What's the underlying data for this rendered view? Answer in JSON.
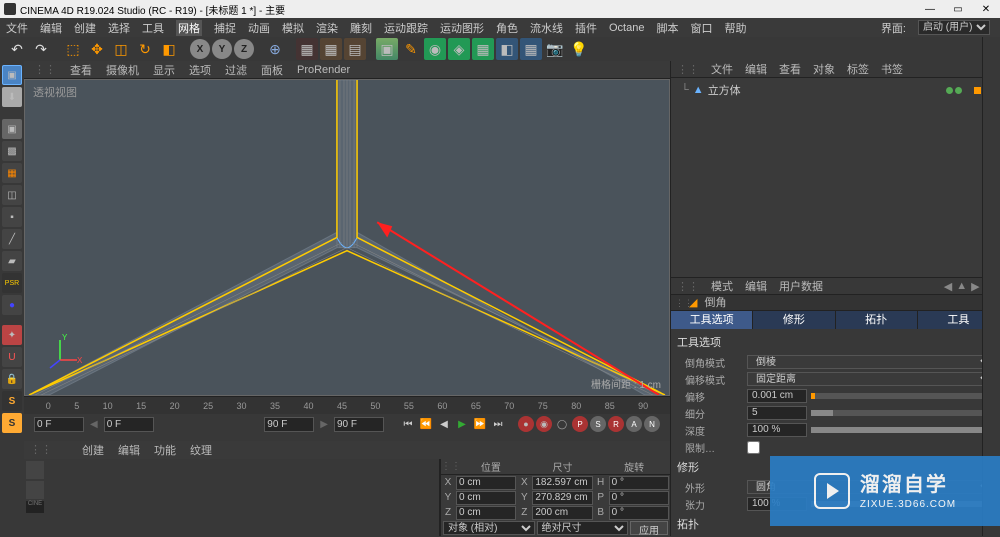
{
  "title": "CINEMA 4D R19.024 Studio (RC - R19) - [未标题 1 *] - 主要",
  "menus": [
    "文件",
    "编辑",
    "创建",
    "选择",
    "工具",
    "网格",
    "捕捉",
    "动画",
    "模拟",
    "渲染",
    "雕刻",
    "运动跟踪",
    "运动图形",
    "角色",
    "流水线",
    "插件",
    "Octane",
    "脚本",
    "窗口",
    "帮助"
  ],
  "layout_label": "界面:",
  "layout_value": "启动 (用户)",
  "axis_labels": {
    "x": "X",
    "y": "Y",
    "z": "Z"
  },
  "viewport_menus": [
    "查看",
    "摄像机",
    "显示",
    "选项",
    "过滤",
    "面板",
    "ProRender"
  ],
  "viewport_label": "透视视图",
  "grid_info": "栅格间距 : 1 cm",
  "timeline": {
    "frames": [
      "0",
      "5",
      "10",
      "15",
      "20",
      "25",
      "30",
      "35",
      "40",
      "45",
      "50",
      "55",
      "60",
      "65",
      "70",
      "75",
      "80",
      "85",
      "90"
    ],
    "start": "0 F",
    "cur": "0 F",
    "range": "90 F",
    "end": "90 F"
  },
  "row2_tabs": [
    "创建",
    "编辑",
    "功能",
    "纹理"
  ],
  "coord": {
    "headers": [
      "位置",
      "尺寸",
      "旋转"
    ],
    "rows": [
      {
        "axis": "X",
        "pos": "0 cm",
        "size": "182.597 cm",
        "rlabel": "H",
        "rot": "0 °"
      },
      {
        "axis": "Y",
        "pos": "0 cm",
        "size": "270.829 cm",
        "rlabel": "P",
        "rot": "0 °"
      },
      {
        "axis": "Z",
        "pos": "0 cm",
        "size": "200 cm",
        "rlabel": "B",
        "rot": "0 °"
      }
    ],
    "mode1": "对象 (相对)",
    "mode2": "绝对尺寸",
    "apply": "应用"
  },
  "obj_header": [
    "文件",
    "编辑",
    "查看",
    "对象",
    "标签",
    "书签"
  ],
  "object_name": "立方体",
  "attr_header": [
    "模式",
    "编辑",
    "用户数据"
  ],
  "attr_title": "倒角",
  "attr_tabs": [
    "工具选项",
    "修形",
    "拓扑",
    "工具"
  ],
  "sec1": "工具选项",
  "bevel_mode_label": "倒角模式",
  "bevel_mode": "倒棱",
  "offset_mode_label": "偏移模式",
  "offset_mode": "固定距离",
  "offset_label": "偏移",
  "offset": "0.001 cm",
  "subdiv_label": "细分",
  "subdiv": "5",
  "depth_label": "深度",
  "depth": "100 %",
  "limit_label": "限制…",
  "sec2": "修形",
  "shape_label": "外形",
  "shape": "圆角",
  "tension_label": "张力",
  "tension": "100 %",
  "sec3": "拓扑",
  "watermark_big": "溜溜自学",
  "watermark_small": "ZIXUE.3D66.COM"
}
